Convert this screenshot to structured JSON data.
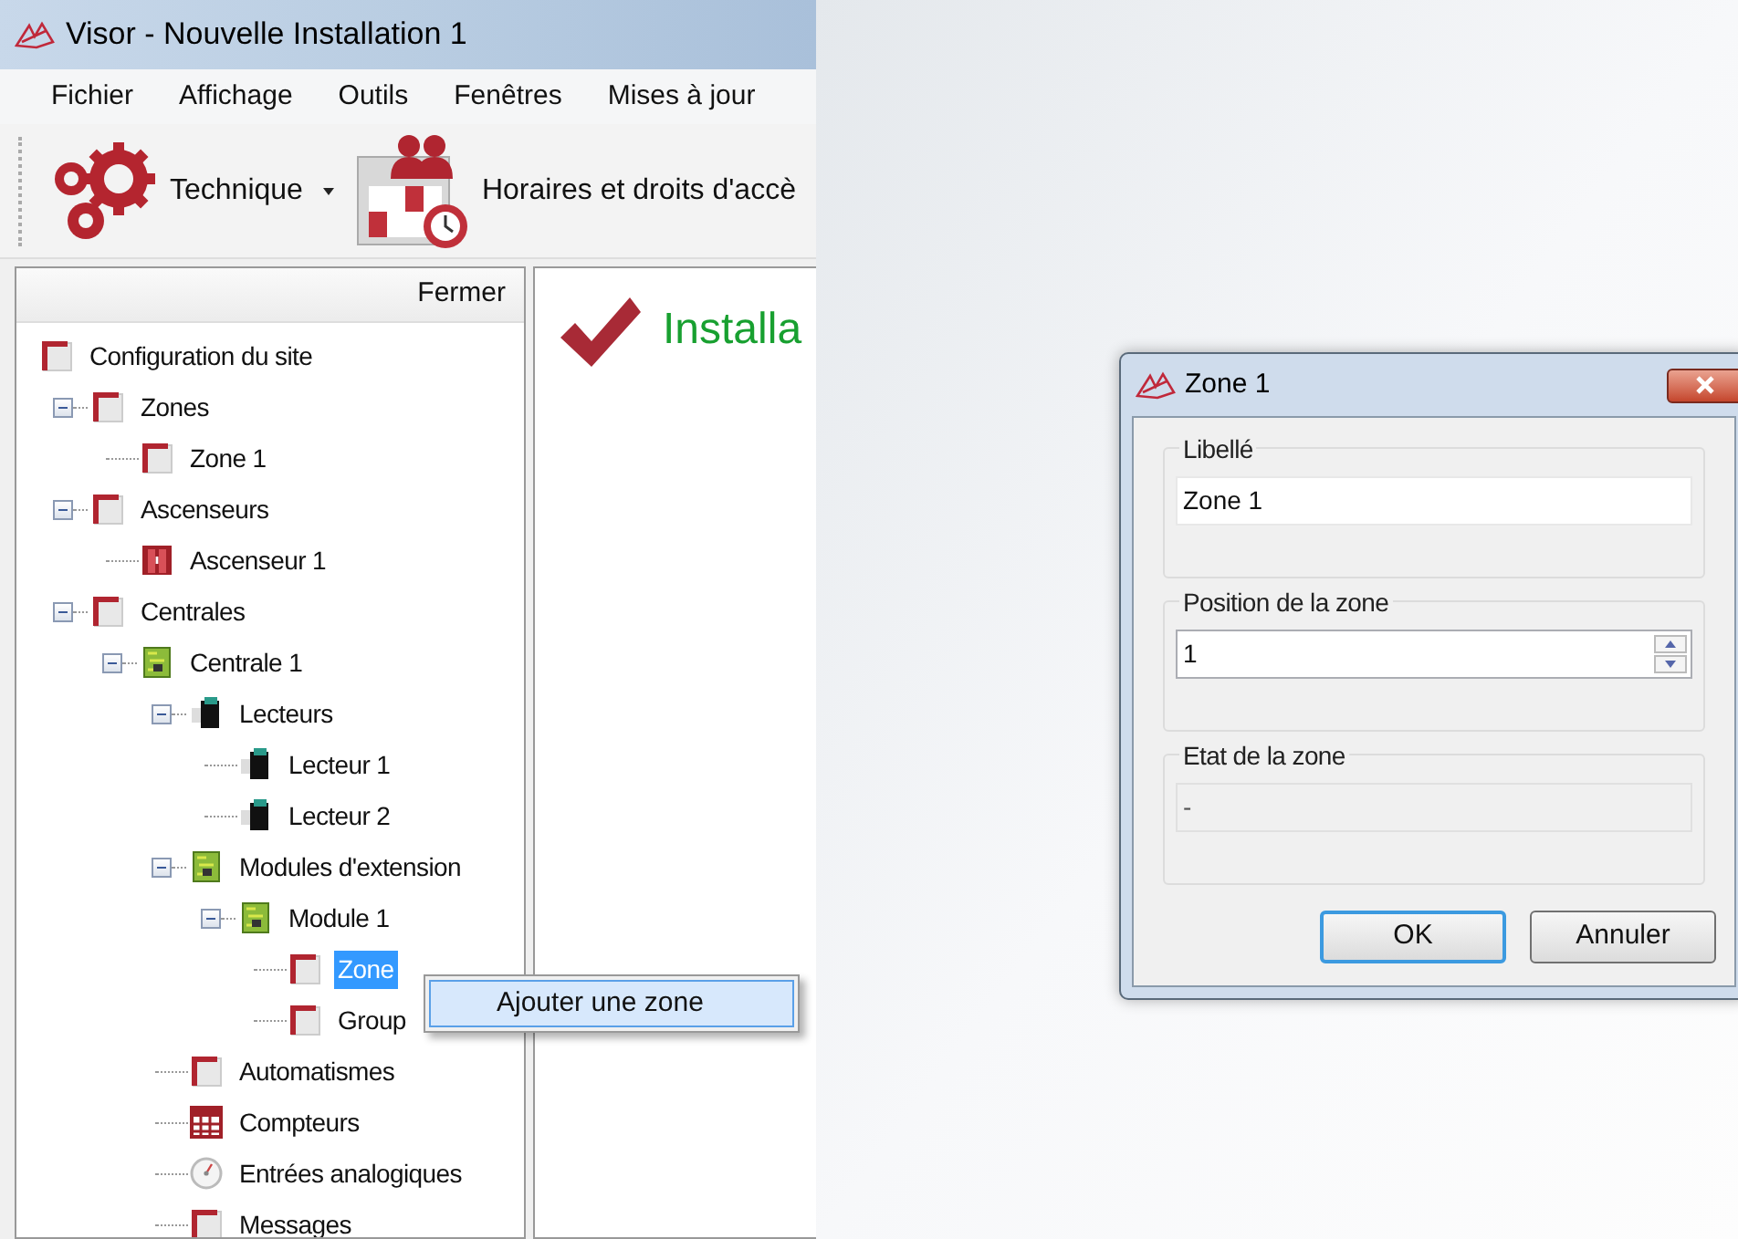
{
  "window": {
    "title": "Visor - Nouvelle Installation 1"
  },
  "menu": [
    "Fichier",
    "Affichage",
    "Outils",
    "Fenêtres",
    "Mises à jour"
  ],
  "toolbar": [
    {
      "kind": "dropdown",
      "label": "Technique"
    },
    {
      "kind": "button",
      "label": "Horaires et droits d'accè"
    }
  ],
  "tree_panel": {
    "close_label": "Fermer",
    "items": [
      {
        "label": "Configuration du site",
        "kind": "folder",
        "selected": false,
        "children": [
          {
            "label": "Zones",
            "kind": "folder",
            "selected": false,
            "expanded": true,
            "children": [
              {
                "label": "Zone 1",
                "kind": "folder",
                "selected": false
              }
            ]
          },
          {
            "label": "Ascenseurs",
            "kind": "folder",
            "selected": false,
            "expanded": true,
            "children": [
              {
                "label": "Ascenseur 1",
                "kind": "elevator",
                "selected": false
              }
            ]
          },
          {
            "label": "Centrales",
            "kind": "folder",
            "selected": false,
            "expanded": true,
            "children": [
              {
                "label": "Centrale 1",
                "kind": "board",
                "selected": false,
                "expanded": true,
                "children": [
                  {
                    "label": "Lecteurs",
                    "kind": "reader",
                    "selected": false,
                    "expanded": true,
                    "children": [
                      {
                        "label": "Lecteur 1",
                        "kind": "reader",
                        "selected": false
                      },
                      {
                        "label": "Lecteur 2",
                        "kind": "reader",
                        "selected": false
                      }
                    ]
                  },
                  {
                    "label": "Modules d'extension",
                    "kind": "board",
                    "selected": false,
                    "expanded": true,
                    "children": [
                      {
                        "label": "Module 1",
                        "kind": "board",
                        "selected": false,
                        "expanded": true,
                        "children": [
                          {
                            "label": "Zone",
                            "kind": "folder",
                            "selected": true
                          },
                          {
                            "label": "Group",
                            "kind": "folder",
                            "selected": false
                          }
                        ]
                      }
                    ]
                  },
                  {
                    "label": "Automatismes",
                    "kind": "folder",
                    "selected": false
                  },
                  {
                    "label": "Compteurs",
                    "kind": "counter",
                    "selected": false
                  },
                  {
                    "label": "Entrées analogiques",
                    "kind": "gauge",
                    "selected": false
                  },
                  {
                    "label": "Messages",
                    "kind": "folder",
                    "selected": false
                  }
                ]
              }
            ]
          }
        ]
      }
    ]
  },
  "content": {
    "heading": "Installa"
  },
  "context_menu": {
    "items": [
      "Ajouter une zone"
    ]
  },
  "dialog": {
    "title": "Zone 1",
    "groups": [
      {
        "label": "Libellé",
        "kind": "text",
        "value": "Zone 1",
        "disabled": false
      },
      {
        "label": "Position de la zone",
        "kind": "spin",
        "value": "1",
        "disabled": false
      },
      {
        "label": "Etat de la zone",
        "kind": "text",
        "value": "-",
        "disabled": true
      }
    ],
    "buttons": [
      {
        "label": "OK",
        "default": true
      },
      {
        "label": "Annuler",
        "default": false
      }
    ]
  }
}
